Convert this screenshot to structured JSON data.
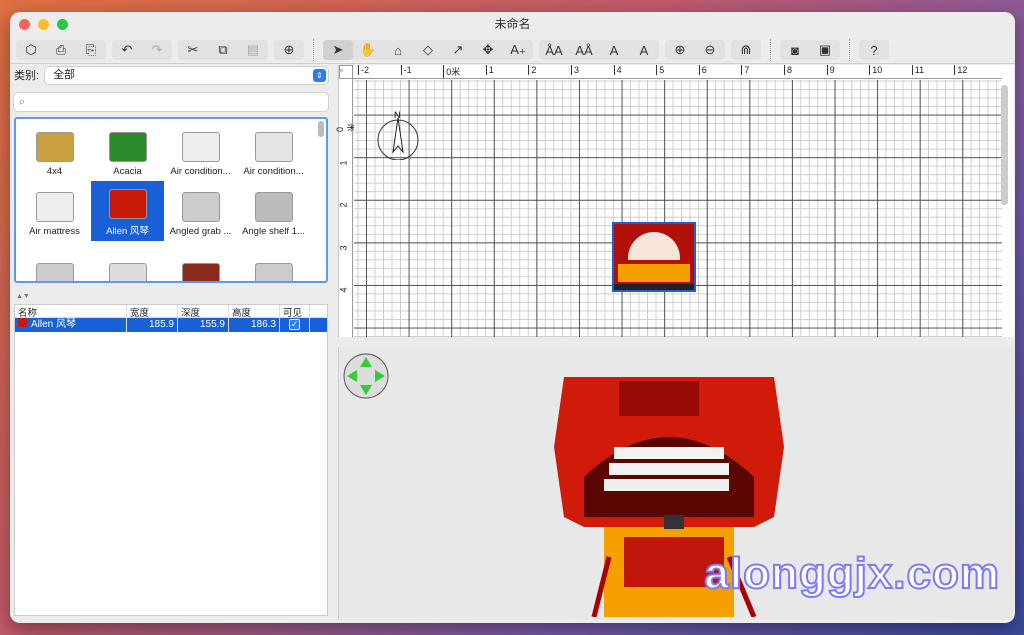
{
  "window": {
    "title": "未命名"
  },
  "toolbar": {
    "groups": [
      [
        "new-home-icon",
        "open-icon",
        "save-icon"
      ],
      [
        "undo-icon",
        "redo-icon"
      ],
      [
        "cut-icon",
        "copy-icon",
        "paste-icon"
      ],
      [
        "add-furniture-icon"
      ],
      [
        "select-icon",
        "pan-icon",
        "create-walls-icon",
        "create-rooms-icon",
        "create-polylines-icon",
        "create-dimensions-icon",
        "add-text-icon"
      ],
      [
        "modify-text-size-icon",
        "decrease-text-size-icon",
        "bold-icon",
        "italic-icon"
      ],
      [
        "zoom-in-icon",
        "zoom-out-icon"
      ],
      [
        "magnetism-icon"
      ],
      [
        "photo-icon",
        "video-icon"
      ],
      [
        "help-icon"
      ]
    ],
    "glyphs": [
      "⬡",
      "⎙",
      "⎘",
      "↶",
      "↷",
      "✂",
      "⧉",
      "▤",
      "⊕",
      "➤",
      "✋",
      "⌂",
      "◇",
      "↗",
      "✥",
      "A₊",
      "ÅA",
      "AÅ",
      "A",
      "A",
      "⊕",
      "⊖",
      "⋒",
      "◙",
      "▣",
      "?"
    ]
  },
  "catalog": {
    "category_label": "类别:",
    "category_value": "全部",
    "search_placeholder": "",
    "items": [
      {
        "name": "4x4"
      },
      {
        "name": "Acacia"
      },
      {
        "name": "Air condition..."
      },
      {
        "name": "Air condition..."
      },
      {
        "name": "Air mattress"
      },
      {
        "name": "Allen 风琴",
        "selected": true
      },
      {
        "name": "Angled grab ..."
      },
      {
        "name": "Angle shelf 1..."
      },
      {
        "name": ""
      },
      {
        "name": ""
      },
      {
        "name": ""
      },
      {
        "name": ""
      }
    ]
  },
  "furniture_table": {
    "headers": [
      "名称",
      "宽度",
      "深度",
      "高度",
      "可见"
    ],
    "rows": [
      {
        "name": "Allen 风琴",
        "width": "185.9",
        "depth": "155.9",
        "height": "186.3",
        "visible": true
      }
    ]
  },
  "plan": {
    "x_ticks": [
      "-2",
      "-1",
      "0米",
      "1",
      "2",
      "3",
      "4",
      "5",
      "6",
      "7",
      "8",
      "9",
      "10",
      "11",
      "12"
    ],
    "y_ticks": [
      "0米",
      "1",
      "2",
      "3",
      "4"
    ],
    "compass_label": "N"
  },
  "watermark": "alonggjx.com",
  "colors": {
    "accent": "#1760d8",
    "organ_red": "#c81a0a",
    "organ_orange": "#f5a000"
  }
}
